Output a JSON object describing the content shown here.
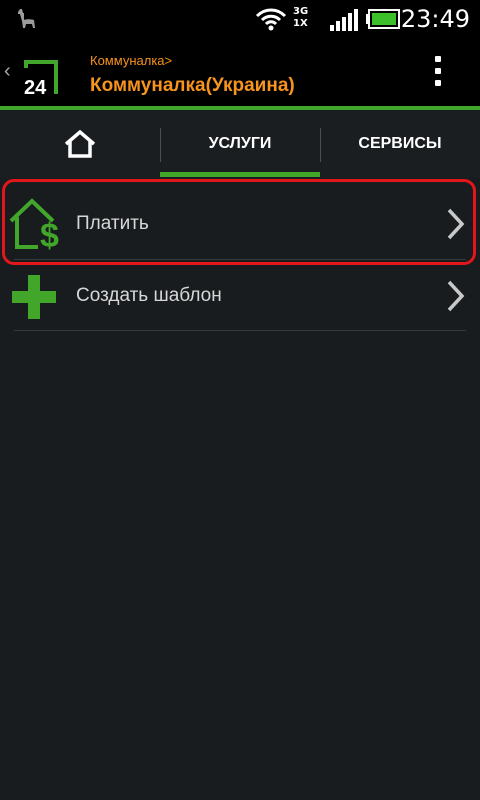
{
  "status_bar": {
    "network_label_top": "3G",
    "network_label_bottom": "1X",
    "time": "23:49"
  },
  "header": {
    "breadcrumb": "Коммуналка>",
    "title": "Коммуналка(Украина)",
    "logo_text": "24"
  },
  "tabs": {
    "services": "УСЛУГИ",
    "other": "СЕРВИСЫ"
  },
  "list": {
    "items": [
      {
        "label": "Платить",
        "icon": "house-dollar-icon"
      },
      {
        "label": "Создать шаблон",
        "icon": "plus-icon"
      }
    ]
  },
  "colors": {
    "accent_orange": "#f7941d",
    "accent_green": "#41a62a",
    "highlight_red": "#e3161c"
  }
}
